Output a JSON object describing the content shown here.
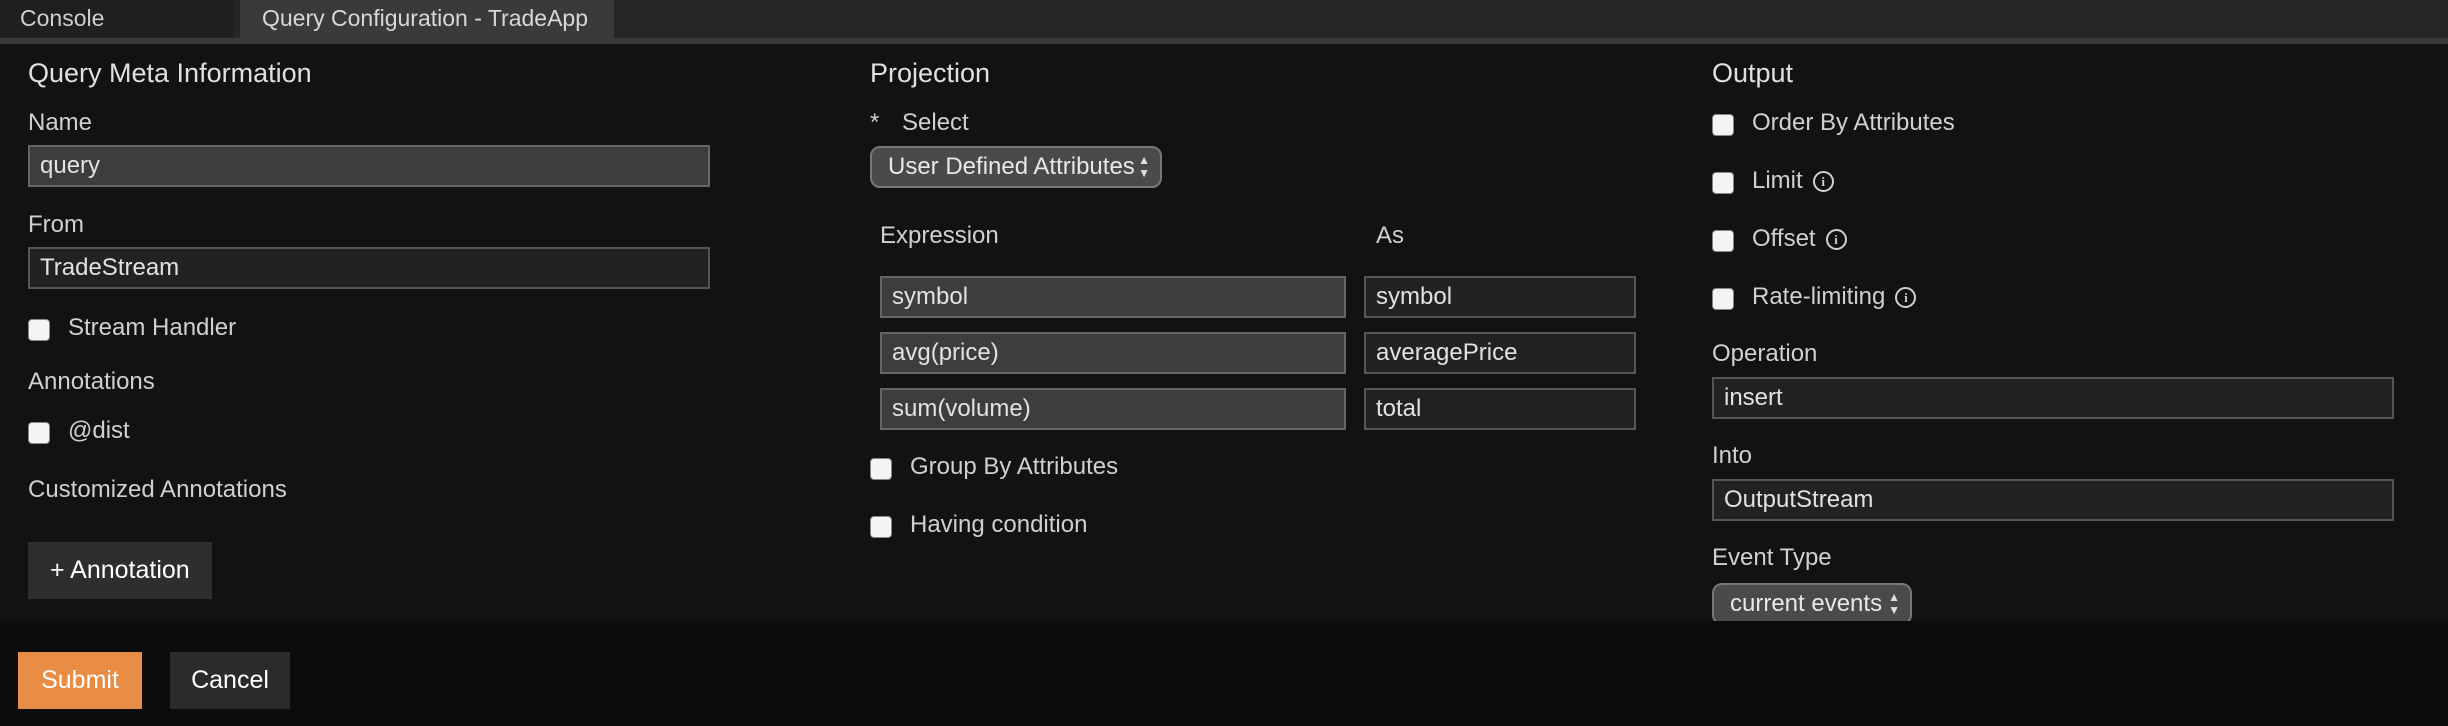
{
  "tabs": [
    {
      "label": "Console",
      "active": false
    },
    {
      "label": "Query Configuration - TradeApp",
      "active": true
    }
  ],
  "meta": {
    "heading": "Query Meta Information",
    "name_label": "Name",
    "name_value": "query",
    "from_label": "From",
    "from_value": "TradeStream",
    "stream_handler_label": "Stream Handler",
    "annotations_label": "Annotations",
    "dist_label": "@dist",
    "customized_label": "Customized Annotations",
    "add_annotation_label": "+ Annotation"
  },
  "projection": {
    "heading": "Projection",
    "required_marker": "*",
    "select_label": "Select",
    "select_value": "User Defined Attributes",
    "expression_header": "Expression",
    "as_header": "As",
    "rows": [
      {
        "expression": "symbol",
        "as": "symbol"
      },
      {
        "expression": "avg(price)",
        "as": "averagePrice"
      },
      {
        "expression": "sum(volume)",
        "as": "total"
      }
    ],
    "group_by_label": "Group By Attributes",
    "having_label": "Having condition"
  },
  "output": {
    "heading": "Output",
    "order_by_label": "Order By Attributes",
    "limit_label": "Limit",
    "offset_label": "Offset",
    "rate_limiting_label": "Rate-limiting",
    "info_glyph": "i",
    "operation_label": "Operation",
    "operation_value": "insert",
    "into_label": "Into",
    "into_value": "OutputStream",
    "event_type_label": "Event Type",
    "event_type_value": "current events"
  },
  "footer": {
    "submit_label": "Submit",
    "cancel_label": "Cancel"
  },
  "colors": {
    "accent": "#e98c44",
    "background": "#121212"
  }
}
